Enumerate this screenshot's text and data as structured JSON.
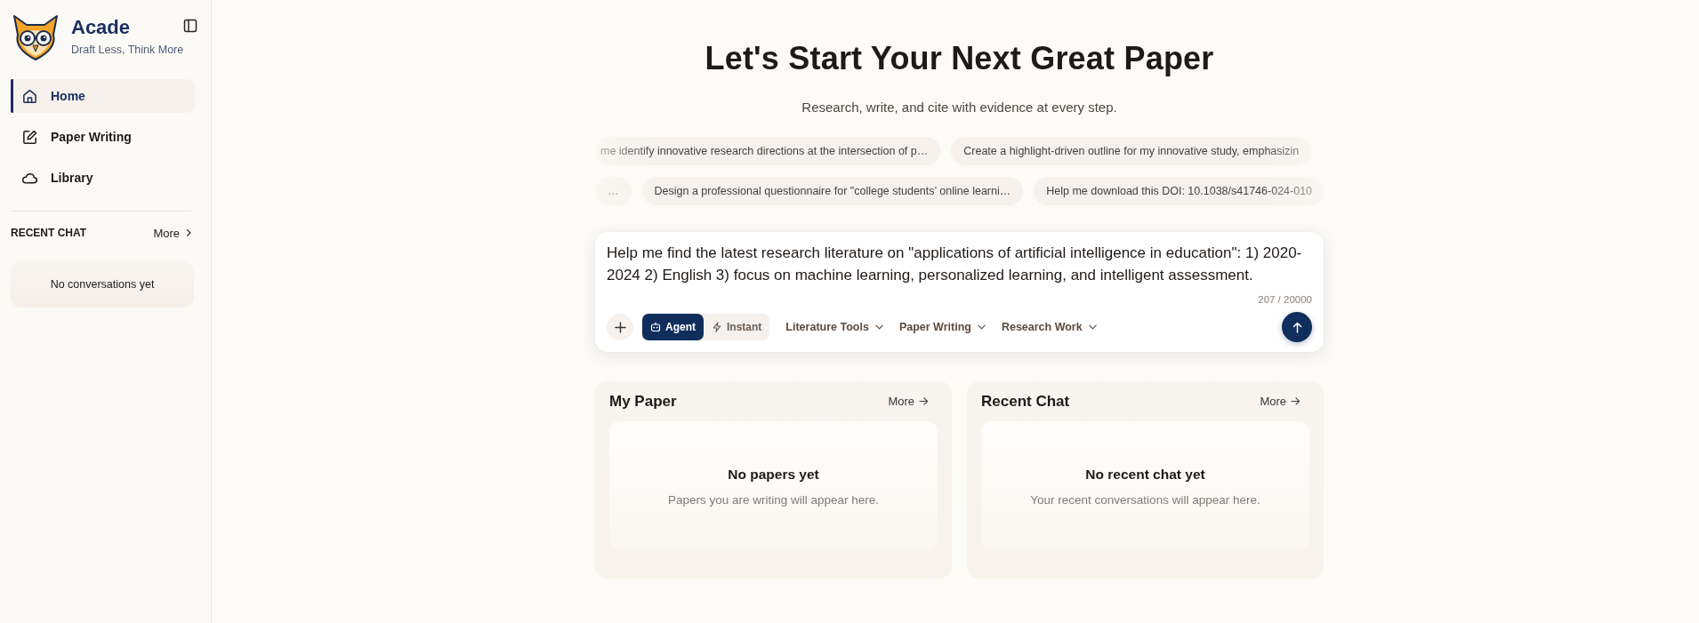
{
  "sidebar": {
    "brand": {
      "name": "Acade",
      "tagline": "Draft Less, Think More"
    },
    "nav": [
      {
        "label": "Home",
        "selected": true
      },
      {
        "label": "Paper Writing",
        "selected": false
      },
      {
        "label": "Library",
        "selected": false
      }
    ],
    "recent_chat": {
      "title": "RECENT CHAT",
      "more": "More",
      "empty": "No conversations yet"
    }
  },
  "hero": {
    "title": "Let's Start Your Next Great Paper",
    "subtitle": "Research, write, and cite with evidence at every step."
  },
  "suggestion_rows": [
    {
      "chips": [
        "me identify innovative research directions at the intersection of p…",
        "Create a highlight-driven outline for my innovative study, emphasizin"
      ]
    },
    {
      "chips": [
        "…",
        "Design a professional questionnaire for \"college students’ online learni…",
        "Help me download this DOI: 10.1038/s41746-024-010"
      ]
    }
  ],
  "composer": {
    "value": "Help me find the latest research literature on \"applications of artificial intelligence in education\": 1) 2020-2024 2) English 3) focus on machine learning, personalized learning, and intelligent assessment.",
    "counter": "207 / 20000",
    "modes": [
      {
        "label": "Agent",
        "selected": true
      },
      {
        "label": "Instant",
        "selected": false
      }
    ],
    "menus": [
      "Literature Tools",
      "Paper Writing",
      "Research Work"
    ]
  },
  "panels": [
    {
      "title": "My Paper",
      "more": "More",
      "empty_title": "No papers yet",
      "empty_text": "Papers you are writing will appear here."
    },
    {
      "title": "Recent Chat",
      "more": "More",
      "empty_title": "No recent chat yet",
      "empty_text": "Your recent conversations will appear here."
    }
  ]
}
